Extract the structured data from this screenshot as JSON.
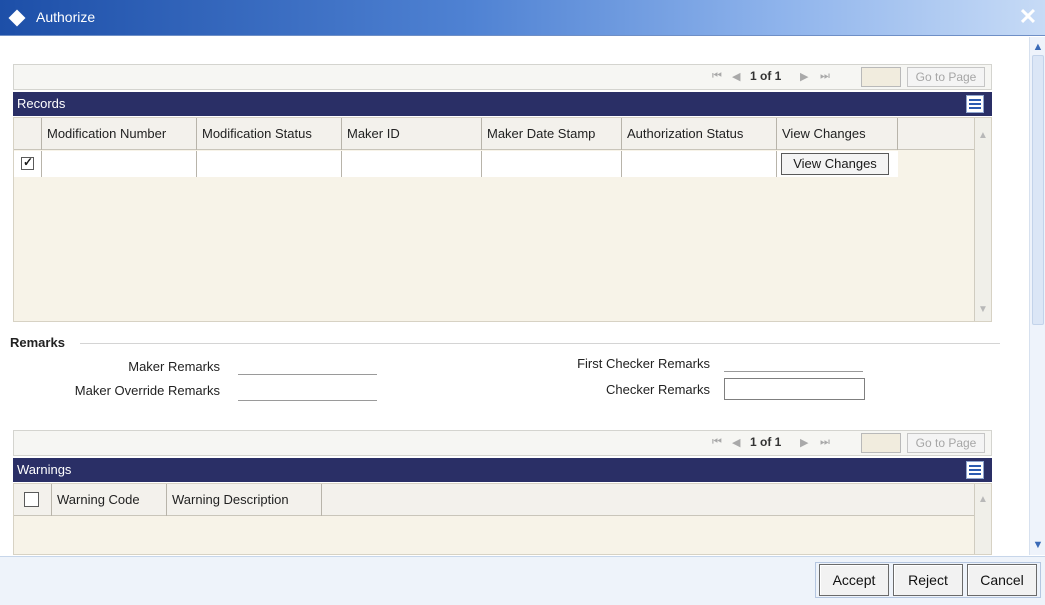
{
  "window": {
    "title": "Authorize",
    "close_glyph": "✕"
  },
  "records_pager": {
    "first": "⏮",
    "prev": "◀",
    "count": "1 of 1",
    "next": "▶",
    "last": "⏭",
    "page_value": "",
    "go_label": "Go to Page"
  },
  "records": {
    "title": "Records",
    "columns": [
      "Modification Number",
      "Modification Status",
      "Maker ID",
      "Maker Date Stamp",
      "Authorization Status",
      "View Changes"
    ],
    "row": {
      "checked": true,
      "view_changes_button": "View Changes"
    }
  },
  "remarks": {
    "title": "Remarks",
    "maker_remarks_label": "Maker Remarks",
    "maker_override_label": "Maker Override Remarks",
    "first_checker_label": "First Checker Remarks",
    "checker_label": "Checker Remarks",
    "checker_value": ""
  },
  "warnings_pager": {
    "first": "⏮",
    "prev": "◀",
    "count": "1 of 1",
    "next": "▶",
    "last": "⏭",
    "page_value": "",
    "go_label": "Go to Page"
  },
  "warnings": {
    "title": "Warnings",
    "columns": [
      "Warning Code",
      "Warning Description"
    ]
  },
  "footer": {
    "accept": "Accept",
    "reject": "Reject",
    "cancel": "Cancel"
  },
  "icons": {
    "scroll_up": "▲",
    "scroll_down": "▼"
  }
}
